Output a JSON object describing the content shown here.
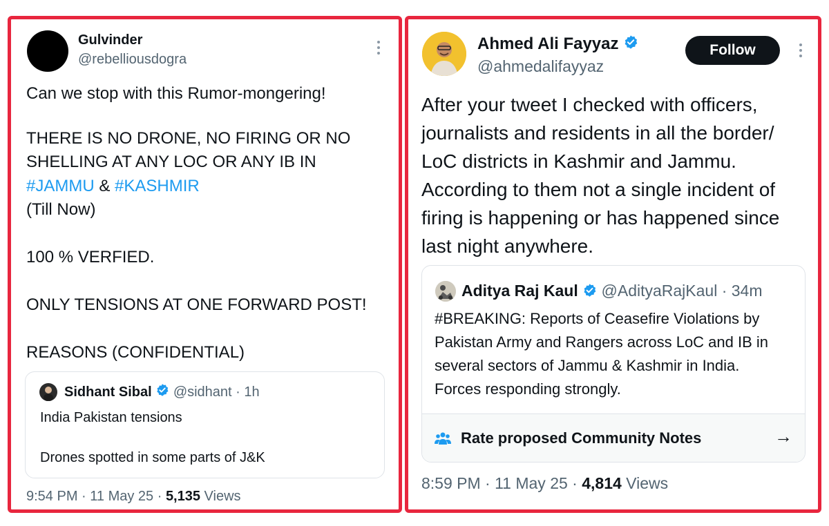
{
  "tweet_left": {
    "name": "Gulvinder",
    "handle": "@rebelliousdogra",
    "text_1": "Can we stop with this Rumor-mongering!",
    "text_2": "THERE IS NO DRONE, NO FIRING OR NO\nSHELLING AT ANY LOC OR ANY IB IN",
    "hashtag_1": "#JAMMU",
    "amp": " & ",
    "hashtag_2": "#KASHMIR",
    "text_3": "(Till Now)",
    "text_4": "100 % VERFIED.",
    "text_5": "ONLY TENSIONS AT ONE FORWARD POST!",
    "text_6": "REASONS (CONFIDENTIAL)",
    "quote": {
      "name": "Sidhant Sibal",
      "handle_time": "@sidhant · 1h",
      "text_1": "India Pakistan tensions",
      "text_2": "Drones spotted in some parts of J&K"
    },
    "time": "9:54 PM · 11 May 25 · ",
    "views_count": "5,135",
    "views_label": " Views"
  },
  "tweet_right": {
    "name": "Ahmed Ali Fayyaz",
    "handle": "@ahmedalifayyaz",
    "follow_label": "Follow",
    "text": "After your tweet I checked with officers,\njournalists and residents in all the border/\nLoC districts in Kashmir and Jammu.\nAccording to them not a single incident of\nfiring is happening or has happened since\nlast night anywhere.",
    "quote": {
      "name": "Aditya Raj Kaul",
      "handle_time": "@AdityaRajKaul · 34m",
      "text": "#BREAKING: Reports of Ceasefire Violations by\nPakistan Army and Rangers across LoC and IB in\nseveral sectors of Jammu & Kashmir in India.\nForces responding strongly.",
      "notes_label": "Rate proposed Community Notes",
      "notes_arrow": "→"
    },
    "time": "8:59 PM · 11 May 25 · ",
    "views_count": "4,814",
    "views_label": " Views"
  },
  "colors": {
    "border_red": "#e8263e",
    "link_blue": "#1d9bf0",
    "verified_blue": "#1d9bf0",
    "muted_gray": "#536471"
  },
  "icons": [
    "more-vertical-icon",
    "verified-badge-icon",
    "community-notes-icon",
    "arrow-right-icon"
  ]
}
